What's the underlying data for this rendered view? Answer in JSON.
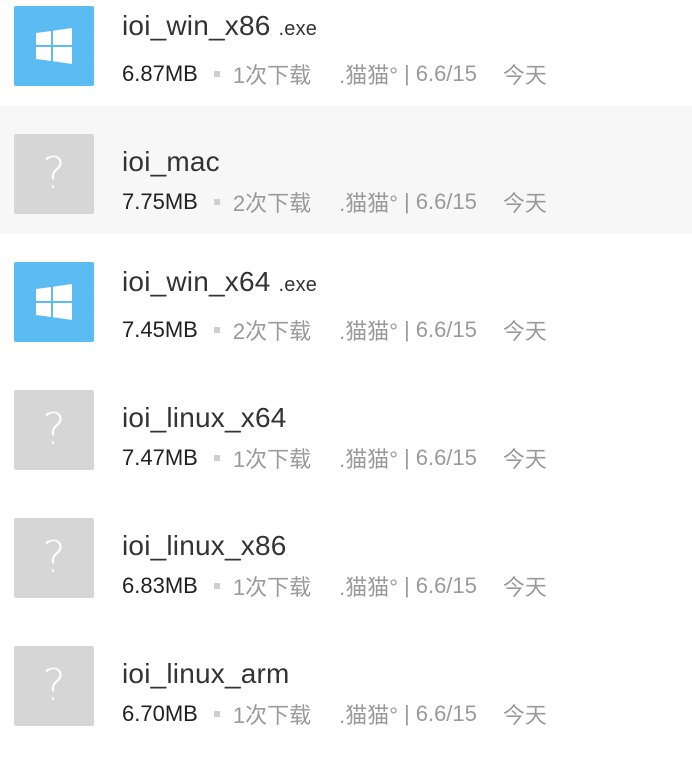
{
  "files": [
    {
      "name": "ioi_win_x86",
      "ext": ".exe",
      "icon": "windows-icon",
      "size": "6.87MB",
      "downloads": "1次下载",
      "uploader": ".猫猫°",
      "sep": "|",
      "date": "6.6/15",
      "time": "今天"
    },
    {
      "name": "ioi_mac",
      "ext": "",
      "icon": "unknown-file-icon",
      "size": "7.75MB",
      "downloads": "2次下载",
      "uploader": ".猫猫°",
      "sep": "|",
      "date": "6.6/15",
      "time": "今天"
    },
    {
      "name": "ioi_win_x64",
      "ext": ".exe",
      "icon": "windows-icon",
      "size": "7.45MB",
      "downloads": "2次下载",
      "uploader": ".猫猫°",
      "sep": "|",
      "date": "6.6/15",
      "time": "今天"
    },
    {
      "name": "ioi_linux_x64",
      "ext": "",
      "icon": "unknown-file-icon",
      "size": "7.47MB",
      "downloads": "1次下载",
      "uploader": ".猫猫°",
      "sep": "|",
      "date": "6.6/15",
      "time": "今天"
    },
    {
      "name": "ioi_linux_x86",
      "ext": "",
      "icon": "unknown-file-icon",
      "size": "6.83MB",
      "downloads": "1次下载",
      "uploader": ".猫猫°",
      "sep": "|",
      "date": "6.6/15",
      "time": "今天"
    },
    {
      "name": "ioi_linux_arm",
      "ext": "",
      "icon": "unknown-file-icon",
      "size": "6.70MB",
      "downloads": "1次下载",
      "uploader": ".猫猫°",
      "sep": "|",
      "date": "6.6/15",
      "time": "今天"
    }
  ],
  "unknown_glyph": "?",
  "colors": {
    "windows_icon_bg": "#5bbcf3",
    "unknown_icon_bg": "#d6d6d6",
    "highlight_row_bg": "#f7f7f7",
    "meta_text": "#9a9a9a",
    "name_text": "#333333"
  }
}
